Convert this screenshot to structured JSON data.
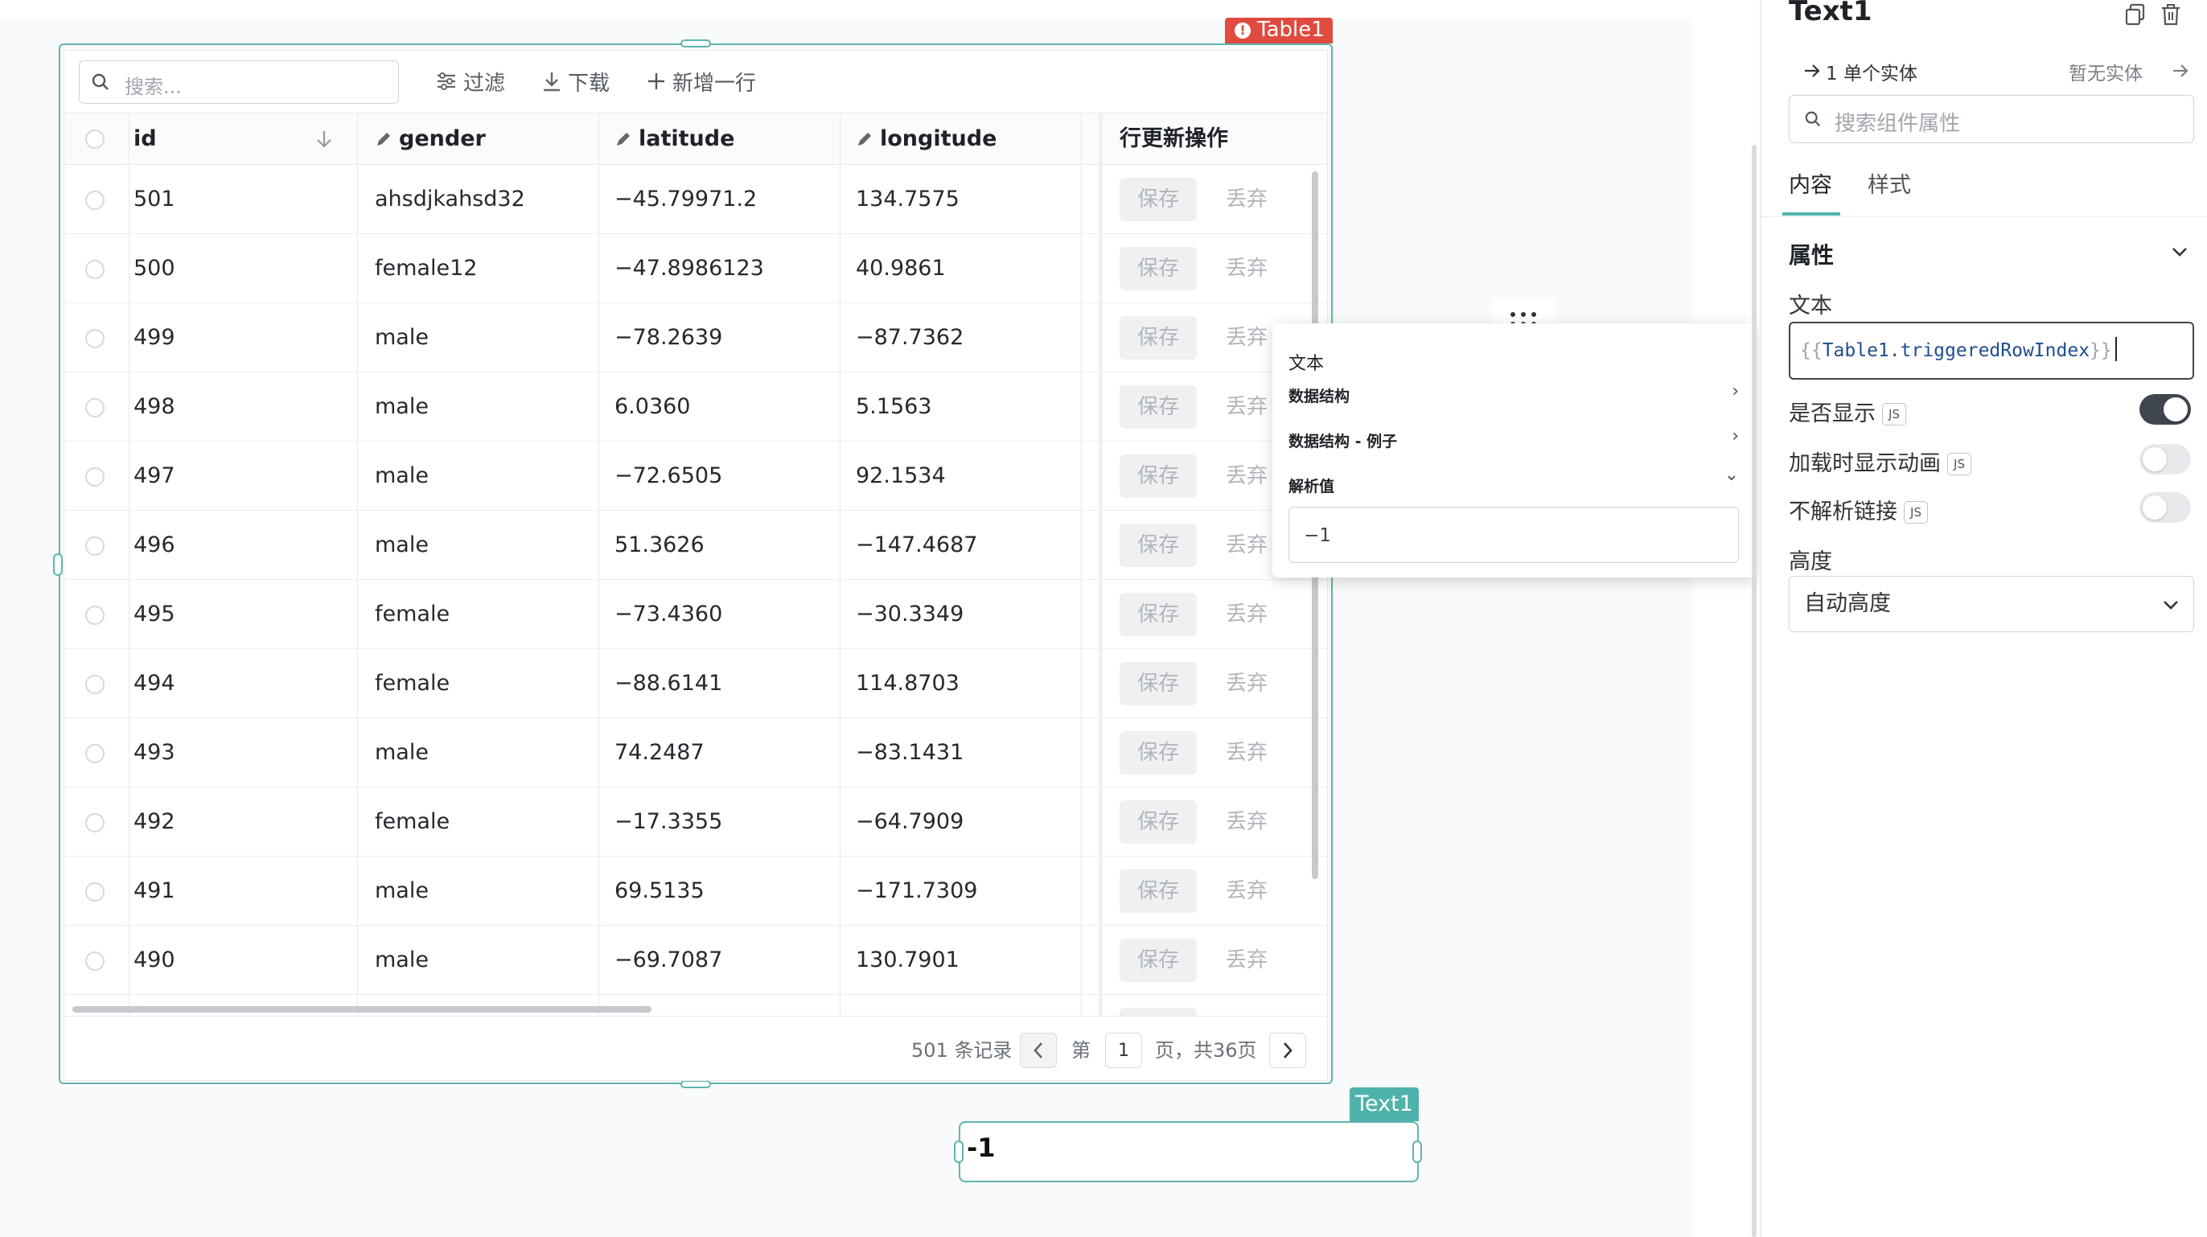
{
  "table": {
    "tag": "Table1",
    "search_placeholder": "搜索...",
    "toolbar": {
      "filter": "过滤",
      "download": "下载",
      "add_row": "新增一行"
    },
    "columns": [
      "id",
      "gender",
      "latitude",
      "longitude",
      "行更新操作"
    ],
    "rows": [
      {
        "id": "501",
        "gender": "ahsdjkahsd32",
        "latitude": "−45.79971.2",
        "longitude": "134.7575"
      },
      {
        "id": "500",
        "gender": "female12",
        "latitude": "−47.8986123",
        "longitude": "40.9861"
      },
      {
        "id": "499",
        "gender": "male",
        "latitude": "−78.2639",
        "longitude": "−87.7362"
      },
      {
        "id": "498",
        "gender": "male",
        "latitude": "6.0360",
        "longitude": "5.1563"
      },
      {
        "id": "497",
        "gender": "male",
        "latitude": "−72.6505",
        "longitude": "92.1534"
      },
      {
        "id": "496",
        "gender": "male",
        "latitude": "51.3626",
        "longitude": "−147.4687"
      },
      {
        "id": "495",
        "gender": "female",
        "latitude": "−73.4360",
        "longitude": "−30.3349"
      },
      {
        "id": "494",
        "gender": "female",
        "latitude": "−88.6141",
        "longitude": "114.8703"
      },
      {
        "id": "493",
        "gender": "male",
        "latitude": "74.2487",
        "longitude": "−83.1431"
      },
      {
        "id": "492",
        "gender": "female",
        "latitude": "−17.3355",
        "longitude": "−64.7909"
      },
      {
        "id": "491",
        "gender": "male",
        "latitude": "69.5135",
        "longitude": "−171.7309"
      },
      {
        "id": "490",
        "gender": "male",
        "latitude": "−69.7087",
        "longitude": "130.7901"
      }
    ],
    "save_label": "保存",
    "discard_label": "丢弃",
    "footer": {
      "records": "501 条记录",
      "page_prefix": "第",
      "page": "1",
      "page_suffix": "页，共36页"
    }
  },
  "popup": {
    "title": "文本",
    "items": [
      {
        "label": "数据结构",
        "chevron": "›"
      },
      {
        "label": "数据结构 - 例子",
        "chevron": "›"
      },
      {
        "label": "解析值",
        "chevron": "⌄"
      }
    ],
    "value": "−1"
  },
  "text_widget": {
    "tag": "Text1",
    "value": "-1"
  },
  "panel": {
    "title": "Text1",
    "entity_left": "1 单个实体",
    "entity_right": "暂无实体",
    "search_placeholder": "搜索组件属性",
    "tabs": [
      "内容",
      "样式"
    ],
    "section": "属性",
    "text_label": "文本",
    "text_value": {
      "open": "{{",
      "expr": "Table1.triggeredRowIndex",
      "close": "}}"
    },
    "visible_label": "是否显示",
    "anim_label": "加载时显示动画",
    "nolink_label": "不解析链接",
    "js_badge": "JS",
    "height_label": "高度",
    "height_value": "自动高度",
    "toggles": {
      "visible": true,
      "anim": false,
      "nolink": false
    }
  },
  "colors": {
    "accent": "#4fb3ab",
    "error_tag": "#e04a3f",
    "toggle_on": "#3f4650"
  }
}
